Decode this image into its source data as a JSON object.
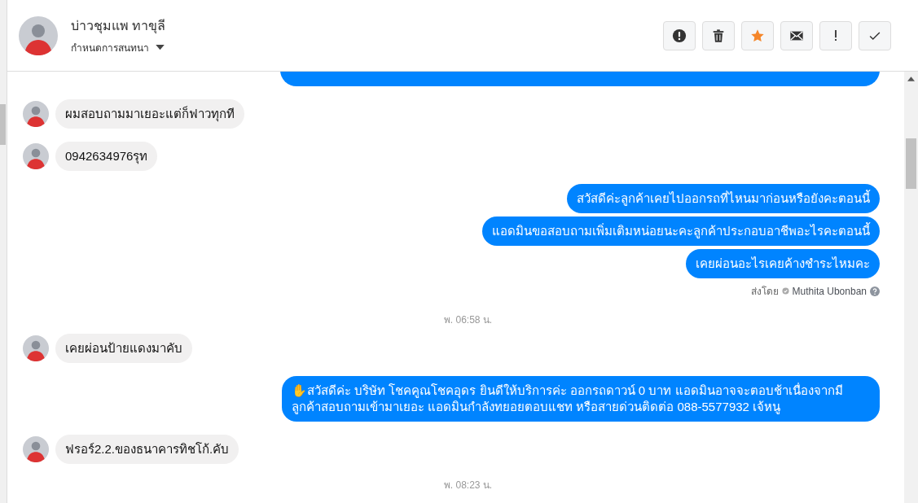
{
  "header": {
    "contact_name": "บ่าวชุมแพ ทาขุลี",
    "subtitle": "กำหนดการสนทนา",
    "actions": [
      {
        "kind": "alert"
      },
      {
        "kind": "trash"
      },
      {
        "kind": "star",
        "selected": true
      },
      {
        "kind": "mail"
      },
      {
        "kind": "bang"
      },
      {
        "kind": "check"
      }
    ]
  },
  "messages": [
    {
      "kind": "cut_outgoing"
    },
    {
      "kind": "incoming",
      "text": "ผมสอบถามมาเยอะแต่ก็ฟาวทุกที"
    },
    {
      "kind": "incoming",
      "text": "0942634976รุท"
    },
    {
      "kind": "outgoing",
      "text": "สวัสดีค่ะลูกค้าเคยไปออกรถที่ไหนมาก่อนหรือยังคะตอนนี้"
    },
    {
      "kind": "outgoing",
      "text": "แอดมินขอสอบถามเพิ่มเติมหน่อยนะคะลูกค้าประกอบอาชีพอะไรคะตอนนี้"
    },
    {
      "kind": "outgoing",
      "text": "เคยผ่อนอะไรเคยค้างชำระไหมคะ"
    },
    {
      "kind": "sender_note",
      "label": "ส่งโดย",
      "name": "Muthita Ubonban"
    },
    {
      "kind": "timestamp",
      "text": "พ. 06:58 น."
    },
    {
      "kind": "incoming",
      "text": "เคยผ่อนป้ายแดงมาคับ"
    },
    {
      "kind": "outgoing",
      "text": "✋สวัสดีค่ะ บริษัท โชคคูณโชคอุดร ยินดีให้บริการค่ะ ออกรถดาวน์ 0 บาท แอดมินอาจจะตอบช้าเนื่องจากมีลูกค้าสอบถามเข้ามาเยอะ แอดมินกำลังทยอยตอบแชท หรือสายด่วนติดต่อ 088-5577932 เจ้หนู"
    },
    {
      "kind": "incoming",
      "text": "ฟรอร์2.2.ของธนาคารทิชโก้.คับ"
    },
    {
      "kind": "timestamp",
      "text": "พ. 08:23 น."
    }
  ]
}
